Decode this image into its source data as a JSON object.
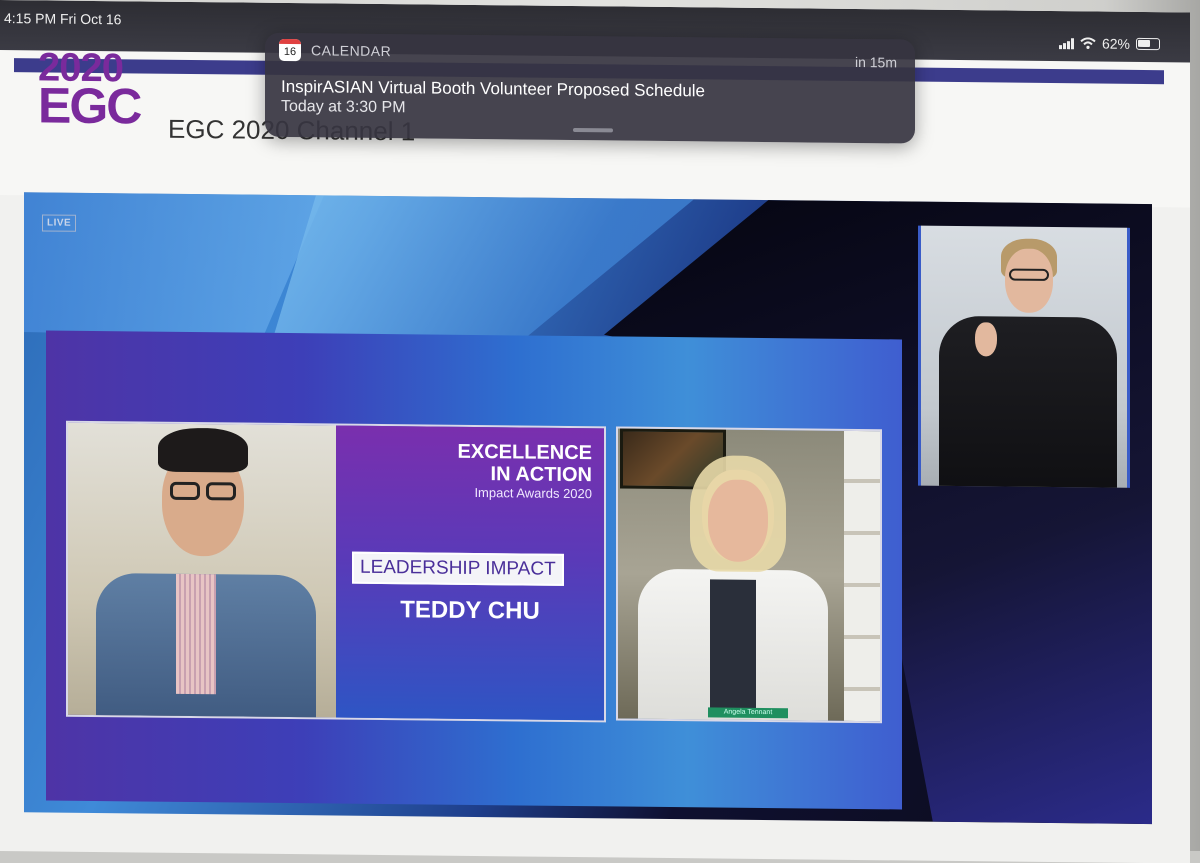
{
  "status_bar": {
    "time": "4:15 PM",
    "date": "Fri Oct 16",
    "battery": "62%",
    "battery_level": 0.62
  },
  "page": {
    "logo_year": "2020",
    "logo_name": "EGC",
    "channel_title": "EGC 2020 Channel 1"
  },
  "video": {
    "live_label": "LIVE",
    "award": {
      "line1": "EXCELLENCE",
      "line2": "IN ACTION",
      "line3": "Impact Awards 2020",
      "category": "LEADERSHIP IMPACT",
      "honoree": "TEDDY CHU"
    },
    "speaker_tag": "Angela Tennant"
  },
  "notification": {
    "icon_day": "16",
    "app": "CALENDAR",
    "when": "in 15m",
    "title": "InspirASIAN Virtual Booth Volunteer Proposed Schedule",
    "time": "Today at 3:30 PM"
  },
  "colors": {
    "brand_purple": "#7a2a9c",
    "stage_blue": "#2c6ab6",
    "award_purple": "#7a2fae"
  },
  "icons": [
    "wifi-icon",
    "signal-icon",
    "battery-icon",
    "calendar-icon"
  ]
}
